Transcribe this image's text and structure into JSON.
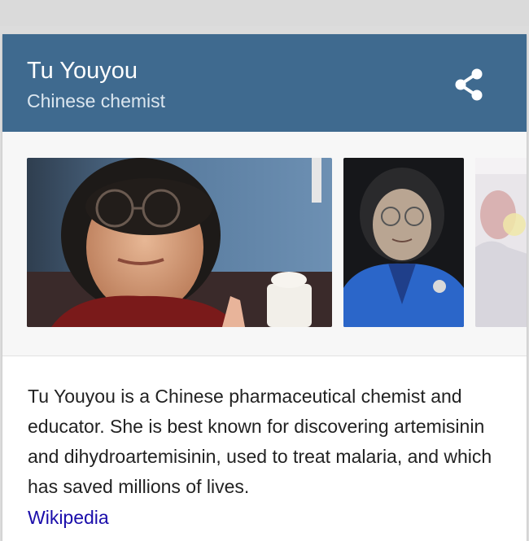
{
  "knowledge_panel": {
    "title": "Tu Youyou",
    "subtitle": "Chinese chemist",
    "share_icon": "share-icon",
    "images": [
      {
        "subject": "portrait-photo"
      },
      {
        "subject": "portrait-photo-blue-jacket"
      },
      {
        "subject": "lab-photo"
      }
    ],
    "description": "Tu Youyou is a Chinese pharmaceutical chemist and educator. She is best known for discovering artemisinin and dihydroartemisinin, used to treat malaria, and which has saved millions of lives.",
    "source_link": "Wikipedia",
    "colors": {
      "header_bg": "#3f6a8f",
      "header_text": "#ffffff",
      "link": "#1a0dab",
      "body_text": "#222222"
    }
  }
}
